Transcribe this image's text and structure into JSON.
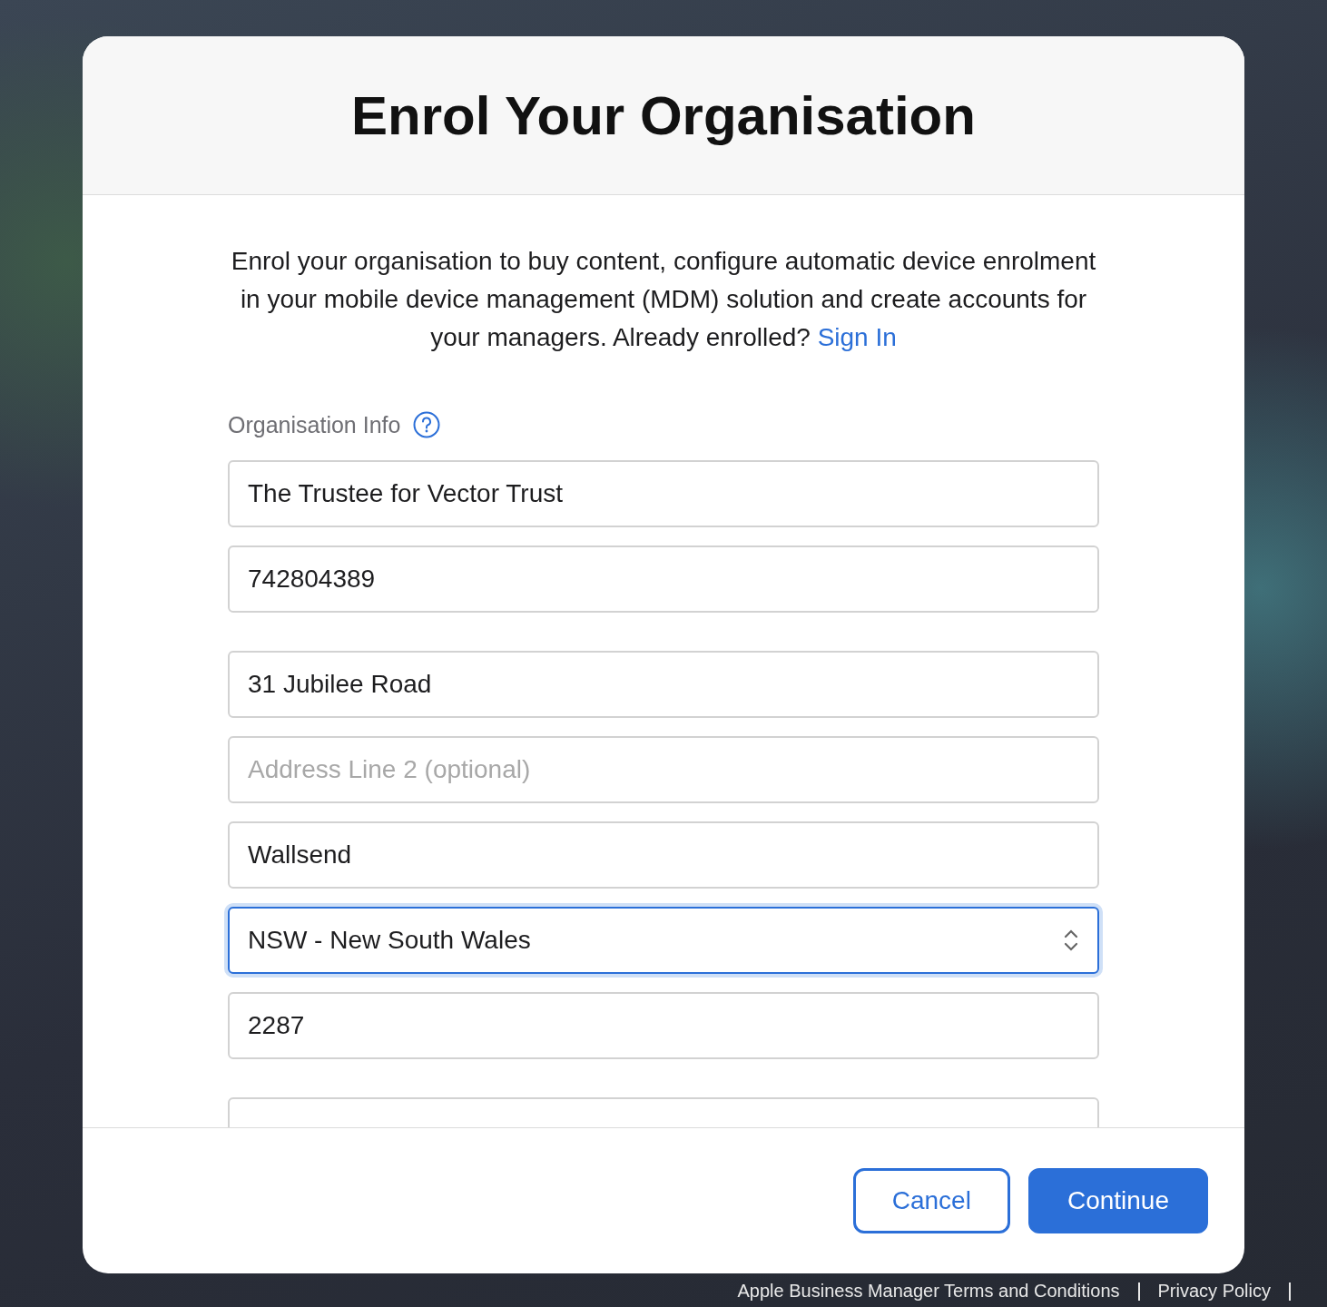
{
  "dialog": {
    "title": "Enrol Your Organisation",
    "intro": "Enrol your organisation to buy content, configure automatic device enrolment in your mobile device management (MDM) solution and create accounts for your managers. Already enrolled?",
    "sign_in_link": "Sign In",
    "section_label": "Organisation Info",
    "field_groups": [
      [
        {
          "kind": "text",
          "value": "The Trustee for Vector Trust",
          "focused": false
        },
        {
          "kind": "text",
          "value": "742804389",
          "focused": false
        }
      ],
      [
        {
          "kind": "text",
          "value": "31 Jubilee Road",
          "focused": false
        },
        {
          "kind": "text",
          "placeholder": "Address Line 2 (optional)",
          "focused": false
        },
        {
          "kind": "text",
          "value": "Wallsend",
          "focused": false
        },
        {
          "kind": "select",
          "value": "NSW - New South Wales",
          "focused": true
        },
        {
          "kind": "text",
          "value": "2287",
          "focused": false
        }
      ],
      [
        {
          "kind": "text",
          "focused": false
        }
      ]
    ],
    "buttons": [
      {
        "label": "Cancel",
        "kind": "secondary"
      },
      {
        "label": "Continue",
        "kind": "primary"
      }
    ]
  },
  "footer_links": [
    "Apple Business Manager Terms and Conditions",
    "Privacy Policy"
  ]
}
